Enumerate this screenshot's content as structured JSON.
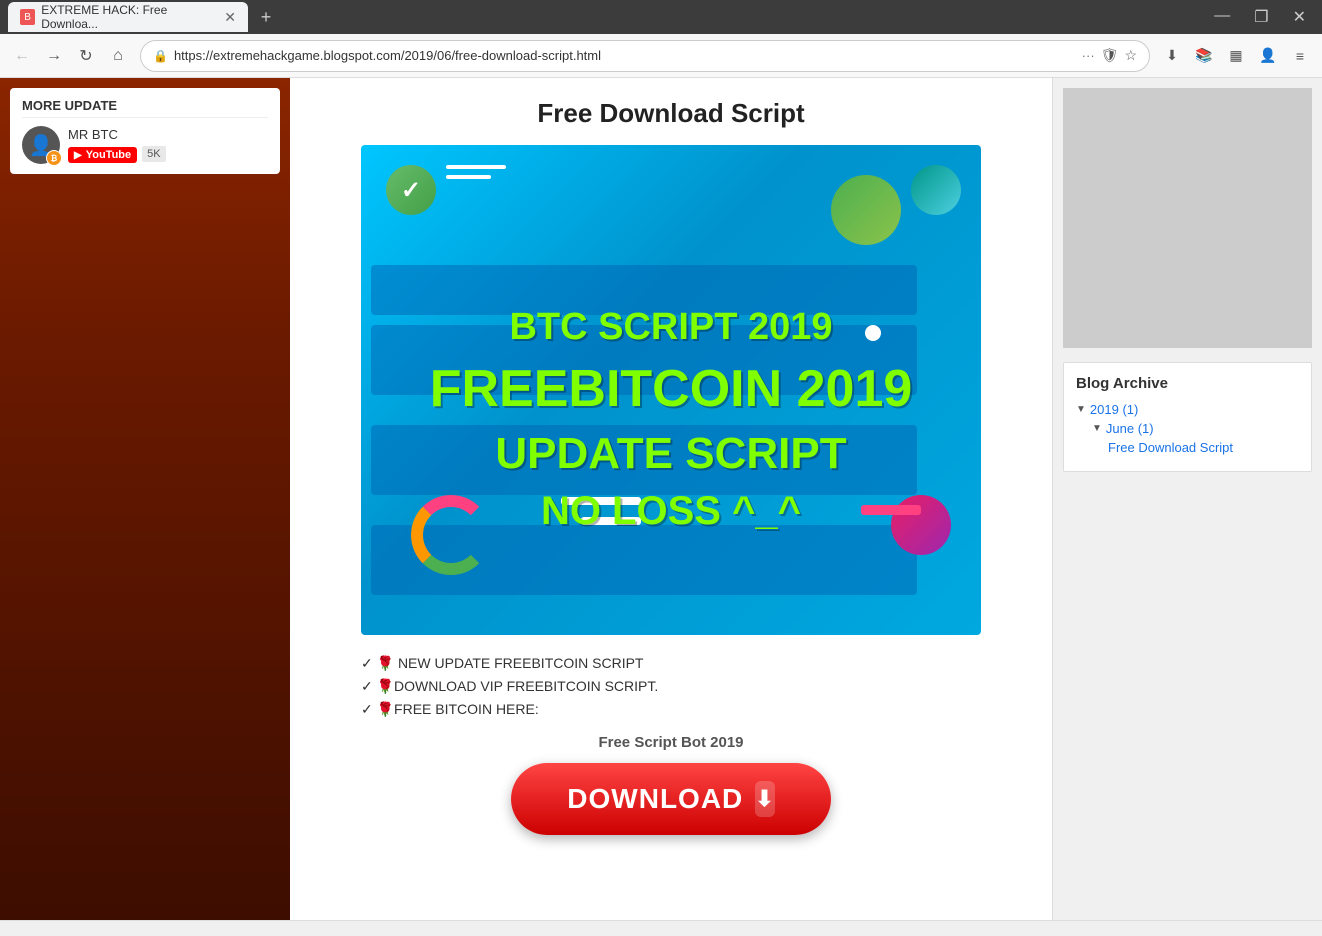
{
  "browser": {
    "tab_title": "EXTREME HACK: Free Downloa...",
    "tab_favicon": "B",
    "url": "https://extremehackgame.blogspot.com/2019/06/free-download-script.html",
    "new_tab_btn": "+",
    "controls": {
      "minimize": "—",
      "maximize": "❐",
      "close": "✕"
    }
  },
  "toolbar": {
    "back_btn": "←",
    "forward_btn": "→",
    "refresh_btn": "↻",
    "home_btn": "⌂",
    "address": "https://extremehackgame.blogspot.com/2019/06/free-download-script.html",
    "more_btn": "···",
    "shield_btn": "🛡",
    "star_btn": "☆",
    "download_btn": "⬇",
    "library_btn": "📚",
    "layout_btn": "▦",
    "account_btn": "👤",
    "menu_btn": "≡"
  },
  "sidebar": {
    "widget_title": "MORE UPDATE",
    "author_name": "MR BTC",
    "youtube_label": "YouTube",
    "sub_count": "5K"
  },
  "main": {
    "post_title": "Free Download Script",
    "banner": {
      "line1": "BTC SCRIPT 2019",
      "line2": "FREEBITCOIN 2019",
      "line3": "UPDATE  SCRIPT",
      "line4": "NO LOSS ^_^"
    },
    "body_lines": [
      "✓ 🌹 NEW UPDATE FREEBITCOIN SCRIPT",
      "✓ 🌹DOWNLOAD VIP FREEBITCOIN SCRIPT.",
      "✓ 🌹FREE BITCOIN HERE:"
    ],
    "free_script_label": "Free Script Bot 2019",
    "download_btn_text": "DOWNLOAD"
  },
  "blog_archive": {
    "title": "Blog Archive",
    "year": "2019 (1)",
    "month": "June (1)",
    "post": "Free Download Script"
  }
}
